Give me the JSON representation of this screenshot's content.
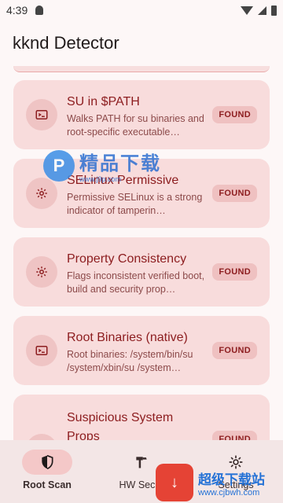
{
  "status_bar": {
    "time": "4:39"
  },
  "app_bar": {
    "title": "kknd Detector"
  },
  "cards": [
    {
      "icon": "terminal-icon",
      "title": "SU in $PATH",
      "desc": "Walks PATH for su binaries and root-specific executable…",
      "badge": "FOUND"
    },
    {
      "icon": "gear-icon",
      "title": "SELinux Permissive",
      "desc": "Permissive SELinux is a strong indicator of tamperin…",
      "badge": "FOUND"
    },
    {
      "icon": "gear-icon",
      "title": "Property Consistency",
      "desc": "Flags inconsistent verified boot, build and security prop…",
      "badge": "FOUND"
    },
    {
      "icon": "terminal-icon",
      "title": "Root Binaries (native)",
      "desc": "Root binaries: /system/bin/su /system/xbin/su /system…",
      "badge": "FOUND"
    },
    {
      "icon": "terminal-icon",
      "title": "Suspicious System Props",
      "desc": "",
      "badge": "FOUND"
    }
  ],
  "bottom_nav": [
    {
      "label": "Root Scan",
      "icon": "shield-icon",
      "active": true
    },
    {
      "label": "HW Secur",
      "icon": "hammer-icon",
      "active": false
    },
    {
      "label": "Settings",
      "icon": "gear-icon",
      "active": false
    }
  ],
  "watermarks": {
    "top": {
      "big": "精品下载",
      "small": "www.j9p.com"
    },
    "bottom": {
      "big": "超级下载站",
      "small": "www.cjbwh.com"
    }
  },
  "colors": {
    "accent": "#8d1e20",
    "card_bg": "#f8dcdc",
    "badge_bg": "#efc1c1"
  }
}
